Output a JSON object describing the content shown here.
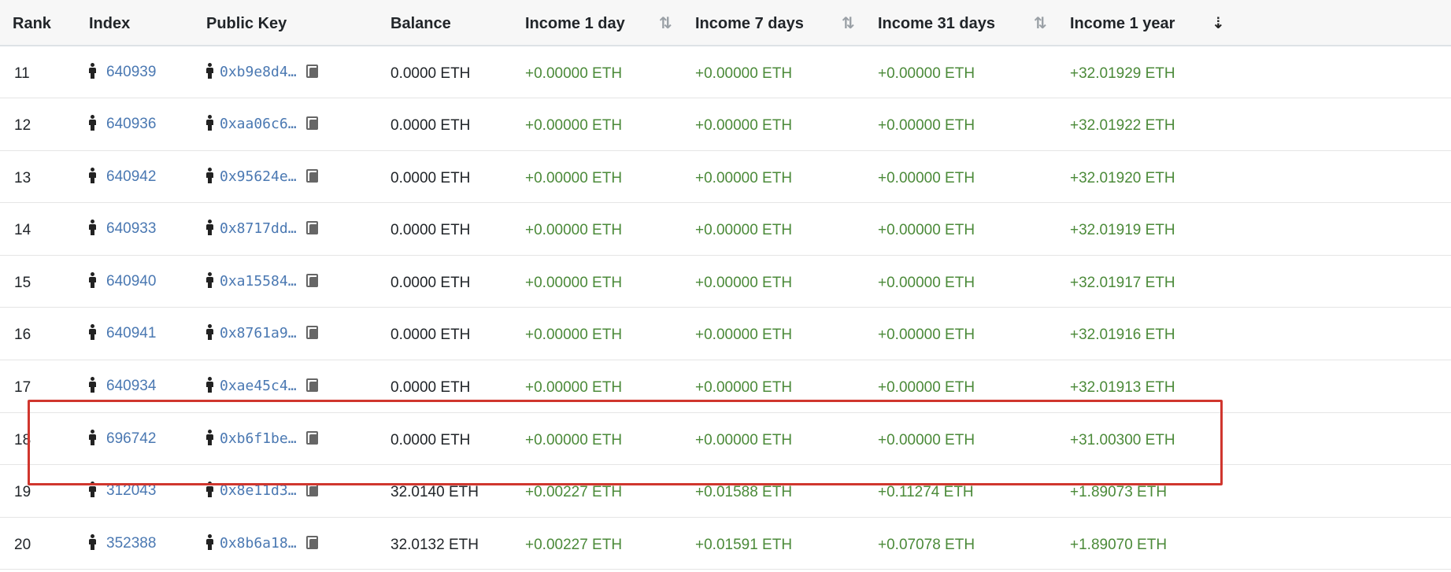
{
  "table": {
    "headers": {
      "rank": "Rank",
      "index": "Index",
      "public_key": "Public Key",
      "balance": "Balance",
      "income_1_day": "Income 1 day",
      "income_7_days": "Income 7 days",
      "income_31_days": "Income 31 days",
      "income_1_year": "Income 1 year"
    },
    "sort_state": {
      "income_1_day": "unsorted",
      "income_7_days": "unsorted",
      "income_31_days": "unsorted",
      "income_1_year": "descending"
    },
    "sort_glyphs": {
      "unsorted": "⇅",
      "descending": "⇣"
    },
    "rows": [
      {
        "rank": "11",
        "index": "640939",
        "public_key": "0xb9e8d4…",
        "balance": "0.0000 ETH",
        "income_1_day": "+0.00000 ETH",
        "income_7_days": "+0.00000 ETH",
        "income_31_days": "+0.00000 ETH",
        "income_1_year": "+32.01929 ETH"
      },
      {
        "rank": "12",
        "index": "640936",
        "public_key": "0xaa06c6…",
        "balance": "0.0000 ETH",
        "income_1_day": "+0.00000 ETH",
        "income_7_days": "+0.00000 ETH",
        "income_31_days": "+0.00000 ETH",
        "income_1_year": "+32.01922 ETH"
      },
      {
        "rank": "13",
        "index": "640942",
        "public_key": "0x95624e…",
        "balance": "0.0000 ETH",
        "income_1_day": "+0.00000 ETH",
        "income_7_days": "+0.00000 ETH",
        "income_31_days": "+0.00000 ETH",
        "income_1_year": "+32.01920 ETH"
      },
      {
        "rank": "14",
        "index": "640933",
        "public_key": "0x8717dd…",
        "balance": "0.0000 ETH",
        "income_1_day": "+0.00000 ETH",
        "income_7_days": "+0.00000 ETH",
        "income_31_days": "+0.00000 ETH",
        "income_1_year": "+32.01919 ETH"
      },
      {
        "rank": "15",
        "index": "640940",
        "public_key": "0xa15584…",
        "balance": "0.0000 ETH",
        "income_1_day": "+0.00000 ETH",
        "income_7_days": "+0.00000 ETH",
        "income_31_days": "+0.00000 ETH",
        "income_1_year": "+32.01917 ETH"
      },
      {
        "rank": "16",
        "index": "640941",
        "public_key": "0x8761a9…",
        "balance": "0.0000 ETH",
        "income_1_day": "+0.00000 ETH",
        "income_7_days": "+0.00000 ETH",
        "income_31_days": "+0.00000 ETH",
        "income_1_year": "+32.01916 ETH"
      },
      {
        "rank": "17",
        "index": "640934",
        "public_key": "0xae45c4…",
        "balance": "0.0000 ETH",
        "income_1_day": "+0.00000 ETH",
        "income_7_days": "+0.00000 ETH",
        "income_31_days": "+0.00000 ETH",
        "income_1_year": "+32.01913 ETH"
      },
      {
        "rank": "18",
        "index": "696742",
        "public_key": "0xb6f1be…",
        "balance": "0.0000 ETH",
        "income_1_day": "+0.00000 ETH",
        "income_7_days": "+0.00000 ETH",
        "income_31_days": "+0.00000 ETH",
        "income_1_year": "+31.00300 ETH"
      },
      {
        "rank": "19",
        "index": "312043",
        "public_key": "0x8e11d3…",
        "balance": "32.0140 ETH",
        "income_1_day": "+0.00227 ETH",
        "income_7_days": "+0.01588 ETH",
        "income_31_days": "+0.11274 ETH",
        "income_1_year": "+1.89073 ETH"
      },
      {
        "rank": "20",
        "index": "352388",
        "public_key": "0x8b6a18…",
        "balance": "32.0132 ETH",
        "income_1_day": "+0.00227 ETH",
        "income_7_days": "+0.01591 ETH",
        "income_31_days": "+0.07078 ETH",
        "income_1_year": "+1.89070 ETH"
      }
    ]
  },
  "icons": {
    "validator": "person-icon",
    "copy": "copy-icon",
    "sort": "sort-arrows-icon"
  },
  "colors": {
    "link": "#4a78b2",
    "positive_income": "#4b8a39",
    "highlight_border": "#d0362e",
    "header_bg": "#f7f7f7"
  }
}
